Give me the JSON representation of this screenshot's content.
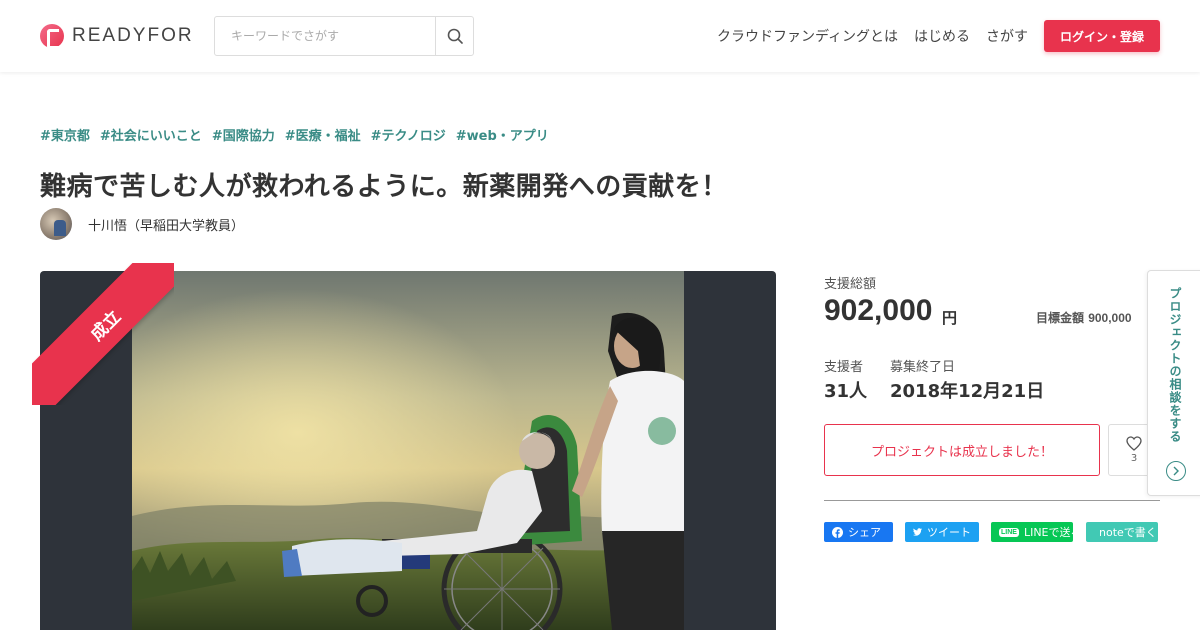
{
  "header": {
    "logo_text": "READYFOR",
    "search": {
      "placeholder": "キーワードでさがす"
    },
    "nav": [
      {
        "label": "クラウドファンディングとは"
      },
      {
        "label": "はじめる"
      },
      {
        "label": "さがす"
      }
    ],
    "login_label": "ログイン・登録"
  },
  "project": {
    "tags": [
      "#東京都",
      "#社会にいいこと",
      "#国際協力",
      "#医療・福祉",
      "#テクノロジ",
      "#web・アプリ"
    ],
    "title": "難病で苦しむ人が救われるように。新薬開発への貢献を！",
    "owner_name": "十川悟（早稲田大学教員）",
    "ribbon_label": "成立"
  },
  "stats": {
    "total_label": "支援総額",
    "total_amount": "902,000",
    "total_unit": "円",
    "goal_label": "目標金額",
    "goal_amount": "900,000",
    "supporters_label": "支援者",
    "supporters_value": "31人",
    "end_label": "募集終了日",
    "end_value": "2018年12月21日"
  },
  "actions": {
    "success_label": "プロジェクトは成立しました！",
    "favorite_count": "3"
  },
  "share": {
    "facebook_label": "シェア",
    "twitter_label": "ツイート",
    "line_icon_text": "LINE",
    "line_label": "LINEで送る",
    "note_label": "noteで書く"
  },
  "side_tab": {
    "label": "プロジェクトの相談をする"
  },
  "colors": {
    "brand": "#e8334d",
    "tag": "#3a8c86",
    "facebook": "#1877f2",
    "twitter": "#1da1f2",
    "line": "#06c755",
    "note": "#41c9b4"
  }
}
